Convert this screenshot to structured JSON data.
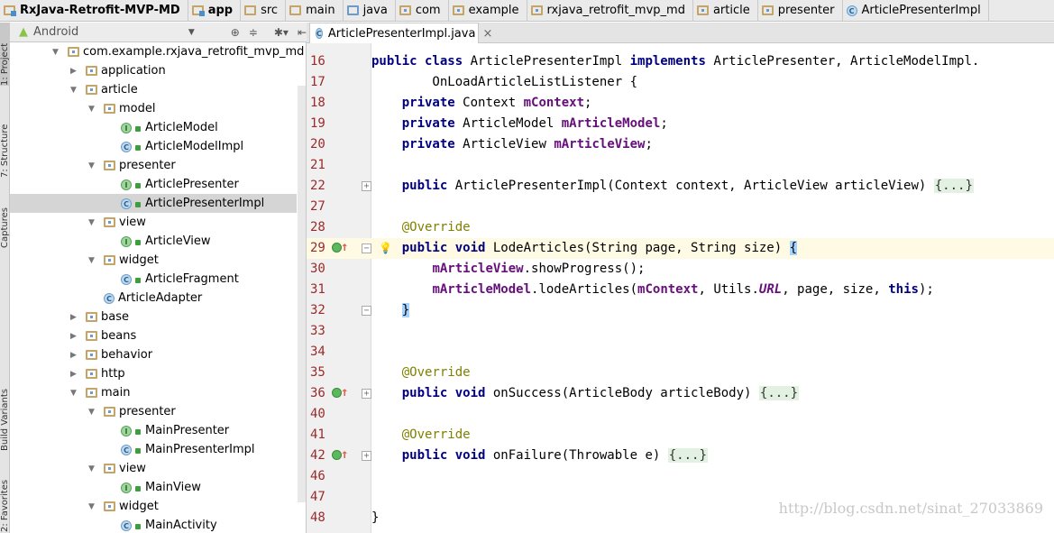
{
  "breadcrumbs": [
    {
      "label": "RxJava-Retrofit-MVP-MD",
      "icon": "module-folder-icon",
      "bold": true
    },
    {
      "label": "app",
      "icon": "module-folder-icon",
      "bold": true
    },
    {
      "label": "src",
      "icon": "folder-icon"
    },
    {
      "label": "main",
      "icon": "folder-icon"
    },
    {
      "label": "java",
      "icon": "source-folder-icon"
    },
    {
      "label": "com",
      "icon": "package-icon"
    },
    {
      "label": "example",
      "icon": "package-icon"
    },
    {
      "label": "rxjava_retrofit_mvp_md",
      "icon": "package-icon"
    },
    {
      "label": "article",
      "icon": "package-icon"
    },
    {
      "label": "presenter",
      "icon": "package-icon"
    },
    {
      "label": "ArticlePresenterImpl",
      "icon": "class-icon"
    }
  ],
  "side_tabs": [
    "1: Project",
    "7: Structure",
    "Captures",
    "Build Variants",
    "2: Favorites"
  ],
  "project_panel": {
    "view_selector": "Android"
  },
  "tree": [
    {
      "label": "com.example.rxjava_retrofit_mvp_md",
      "depth": 0,
      "type": "package",
      "arrow": "down"
    },
    {
      "label": "application",
      "depth": 1,
      "type": "package",
      "arrow": "right"
    },
    {
      "label": "article",
      "depth": 1,
      "type": "package",
      "arrow": "down"
    },
    {
      "label": "model",
      "depth": 2,
      "type": "package",
      "arrow": "down"
    },
    {
      "label": "ArticleModel",
      "depth": 3,
      "type": "I"
    },
    {
      "label": "ArticleModelImpl",
      "depth": 3,
      "type": "C"
    },
    {
      "label": "presenter",
      "depth": 2,
      "type": "package",
      "arrow": "down"
    },
    {
      "label": "ArticlePresenter",
      "depth": 3,
      "type": "I"
    },
    {
      "label": "ArticlePresenterImpl",
      "depth": 3,
      "type": "C",
      "selected": true
    },
    {
      "label": "view",
      "depth": 2,
      "type": "package",
      "arrow": "down"
    },
    {
      "label": "ArticleView",
      "depth": 3,
      "type": "I"
    },
    {
      "label": "widget",
      "depth": 2,
      "type": "package",
      "arrow": "down"
    },
    {
      "label": "ArticleFragment",
      "depth": 3,
      "type": "C"
    },
    {
      "label": "ArticleAdapter",
      "depth": 2,
      "type": "C"
    },
    {
      "label": "base",
      "depth": 1,
      "type": "package",
      "arrow": "right"
    },
    {
      "label": "beans",
      "depth": 1,
      "type": "package",
      "arrow": "right"
    },
    {
      "label": "behavior",
      "depth": 1,
      "type": "package",
      "arrow": "right"
    },
    {
      "label": "http",
      "depth": 1,
      "type": "package",
      "arrow": "right"
    },
    {
      "label": "main",
      "depth": 1,
      "type": "package",
      "arrow": "down"
    },
    {
      "label": "presenter",
      "depth": 2,
      "type": "package",
      "arrow": "down"
    },
    {
      "label": "MainPresenter",
      "depth": 3,
      "type": "I"
    },
    {
      "label": "MainPresenterImpl",
      "depth": 3,
      "type": "C"
    },
    {
      "label": "view",
      "depth": 2,
      "type": "package",
      "arrow": "down"
    },
    {
      "label": "MainView",
      "depth": 3,
      "type": "I"
    },
    {
      "label": "widget",
      "depth": 2,
      "type": "package",
      "arrow": "down"
    },
    {
      "label": "MainActivity",
      "depth": 3,
      "type": "C"
    }
  ],
  "editor_tab": {
    "label": "ArticlePresenterImpl.java",
    "close": "×"
  },
  "code": [
    {
      "n": "16",
      "t": [
        [
          "kw",
          "public class "
        ],
        [
          "",
          "ArticlePresenterImpl "
        ],
        [
          "kw",
          "implements "
        ],
        [
          "",
          "ArticlePresenter, ArticleModelImpl."
        ]
      ]
    },
    {
      "n": "17",
      "t": [
        [
          "",
          "        OnLoadArticleListListener {"
        ]
      ]
    },
    {
      "n": "18",
      "t": [
        [
          "",
          "    "
        ],
        [
          "kw",
          "private "
        ],
        [
          "",
          "Context "
        ],
        [
          "fd",
          "mContext"
        ],
        [
          "",
          ";"
        ]
      ]
    },
    {
      "n": "19",
      "t": [
        [
          "",
          "    "
        ],
        [
          "kw",
          "private "
        ],
        [
          "",
          "ArticleModel "
        ],
        [
          "fd",
          "mArticleModel"
        ],
        [
          "",
          ";"
        ]
      ]
    },
    {
      "n": "20",
      "t": [
        [
          "",
          "    "
        ],
        [
          "kw",
          "private "
        ],
        [
          "",
          "ArticleView "
        ],
        [
          "fd",
          "mArticleView"
        ],
        [
          "",
          ";"
        ]
      ]
    },
    {
      "n": "21",
      "t": []
    },
    {
      "n": "22",
      "fold": "+",
      "t": [
        [
          "",
          "    "
        ],
        [
          "kw",
          "public "
        ],
        [
          "",
          "ArticlePresenterImpl(Context context, ArticleView articleView) "
        ],
        [
          "fo",
          "{...}"
        ]
      ]
    },
    {
      "n": "27",
      "t": []
    },
    {
      "n": "28",
      "t": [
        [
          "",
          "    "
        ],
        [
          "an",
          "@Override"
        ]
      ]
    },
    {
      "n": "29",
      "hl": true,
      "impl": true,
      "fold": "-",
      "bulb": true,
      "t": [
        [
          "",
          "    "
        ],
        [
          "kw",
          "public void "
        ],
        [
          "",
          "LodeArticles(String page, String size) "
        ],
        [
          "bm",
          "{"
        ]
      ]
    },
    {
      "n": "30",
      "t": [
        [
          "",
          "        "
        ],
        [
          "fd",
          "mArticleView"
        ],
        [
          "",
          ".showProgress();"
        ]
      ]
    },
    {
      "n": "31",
      "t": [
        [
          "",
          "        "
        ],
        [
          "fd",
          "mArticleModel"
        ],
        [
          "",
          ".lodeArticles("
        ],
        [
          "fd",
          "mContext"
        ],
        [
          "",
          ", Utils."
        ],
        [
          "it",
          "URL"
        ],
        [
          "",
          ", page, size, "
        ],
        [
          "kw",
          "this"
        ],
        [
          "",
          ");"
        ]
      ]
    },
    {
      "n": "32",
      "fold": "-",
      "t": [
        [
          "",
          "    "
        ],
        [
          "bm",
          "}"
        ]
      ]
    },
    {
      "n": "33",
      "t": []
    },
    {
      "n": "34",
      "t": []
    },
    {
      "n": "35",
      "t": [
        [
          "",
          "    "
        ],
        [
          "an",
          "@Override"
        ]
      ]
    },
    {
      "n": "36",
      "impl": true,
      "fold": "+",
      "t": [
        [
          "",
          "    "
        ],
        [
          "kw",
          "public void "
        ],
        [
          "",
          "onSuccess(ArticleBody articleBody) "
        ],
        [
          "fo",
          "{...}"
        ]
      ]
    },
    {
      "n": "40",
      "t": []
    },
    {
      "n": "41",
      "t": [
        [
          "",
          "    "
        ],
        [
          "an",
          "@Override"
        ]
      ]
    },
    {
      "n": "42",
      "impl": true,
      "fold": "+",
      "t": [
        [
          "",
          "    "
        ],
        [
          "kw",
          "public void "
        ],
        [
          "",
          "onFailure(Throwable e) "
        ],
        [
          "fo",
          "{...}"
        ]
      ]
    },
    {
      "n": "46",
      "t": []
    },
    {
      "n": "47",
      "t": []
    },
    {
      "n": "48",
      "t": [
        [
          "",
          "}"
        ]
      ]
    }
  ],
  "watermark": "http://blog.csdn.net/sinat_27033869"
}
